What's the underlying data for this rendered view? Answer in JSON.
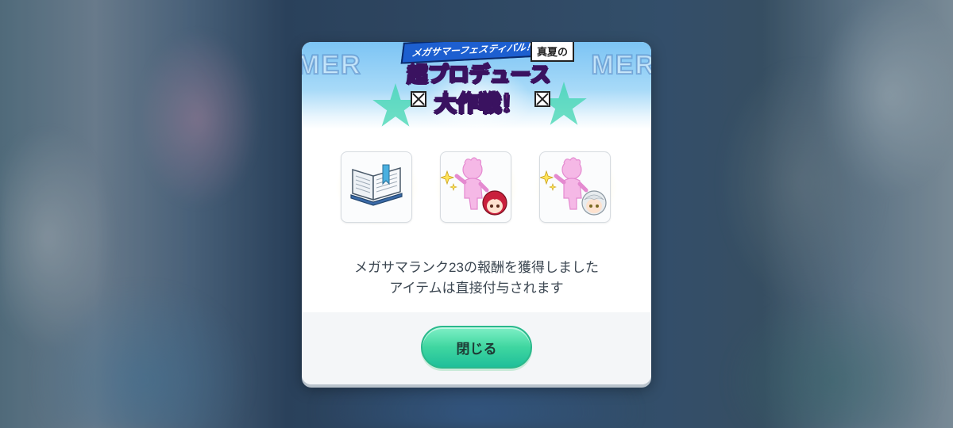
{
  "event_logo": {
    "subtitle": "メガサマーフェスティバル！",
    "subtitle2": "真夏の",
    "title_line1": "超プロデュース",
    "title_line2": "大作戦！",
    "banner_deco_left": "MER",
    "banner_deco_right": "MER"
  },
  "rewards": [
    {
      "icon": "open-book-icon"
    },
    {
      "icon": "pink-silhouette-red-hair-chibi-icon"
    },
    {
      "icon": "pink-silhouette-white-hair-chibi-icon"
    }
  ],
  "message": {
    "line1": "メガサマランク23の報酬を獲得しました",
    "line2": "アイテムは直接付与されます"
  },
  "buttons": {
    "close_label": "閉じる"
  },
  "colors": {
    "button_green": "#3fd6a0",
    "banner_blue": "#7cc4f4"
  }
}
